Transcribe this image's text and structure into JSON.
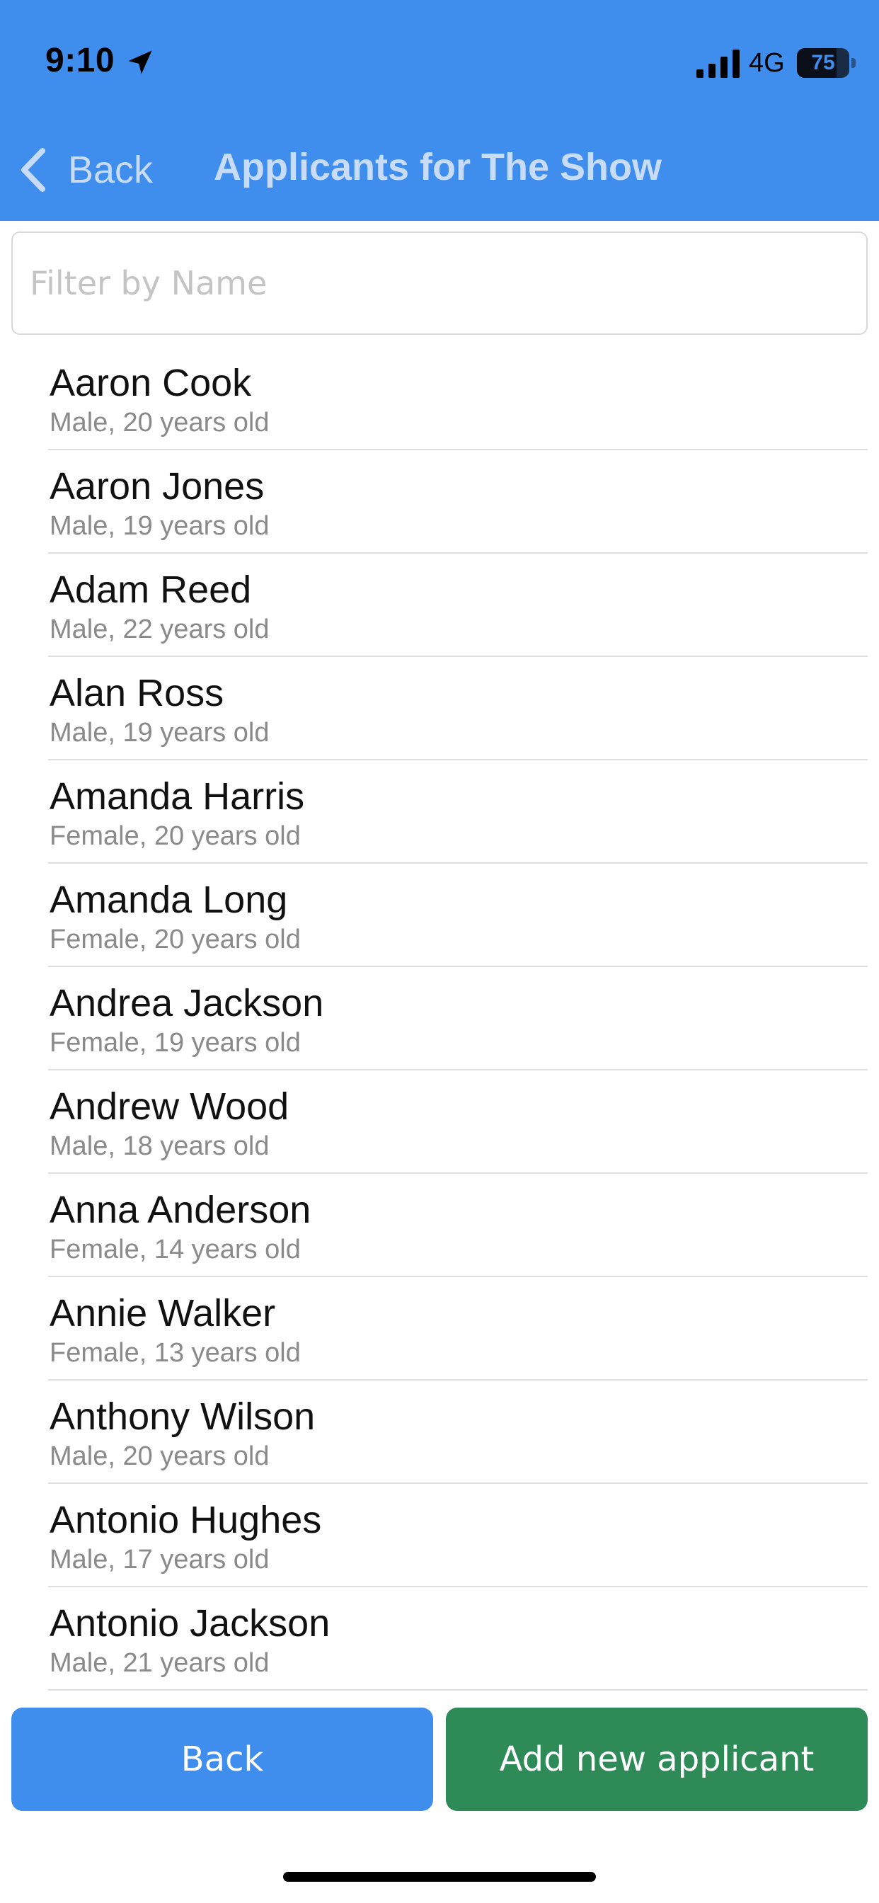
{
  "status_bar": {
    "time": "9:10",
    "network": "4G",
    "battery_level": "75",
    "battery_fraction": 0.75
  },
  "nav": {
    "back_label": "Back",
    "title": "Applicants for The Show"
  },
  "filter": {
    "placeholder": "Filter by Name",
    "value": ""
  },
  "applicants": [
    {
      "name": "Aaron Cook",
      "detail": "Male, 20 years old"
    },
    {
      "name": "Aaron Jones",
      "detail": "Male, 19 years old"
    },
    {
      "name": "Adam Reed",
      "detail": "Male, 22 years old"
    },
    {
      "name": "Alan Ross",
      "detail": "Male, 19 years old"
    },
    {
      "name": "Amanda Harris",
      "detail": "Female, 20 years old"
    },
    {
      "name": "Amanda Long",
      "detail": "Female, 20 years old"
    },
    {
      "name": "Andrea Jackson",
      "detail": "Female, 19 years old"
    },
    {
      "name": "Andrew Wood",
      "detail": "Male, 18 years old"
    },
    {
      "name": "Anna Anderson",
      "detail": "Female, 14 years old"
    },
    {
      "name": "Annie Walker",
      "detail": "Female, 13 years old"
    },
    {
      "name": "Anthony Wilson",
      "detail": "Male, 20 years old"
    },
    {
      "name": "Antonio Hughes",
      "detail": "Male, 17 years old"
    },
    {
      "name": "Antonio Jackson",
      "detail": "Male, 21 years old"
    }
  ],
  "footer": {
    "back_label": "Back",
    "add_label": "Add new applicant"
  },
  "colors": {
    "header_blue": "#3f8ded",
    "add_green": "#2e8b57",
    "detail_gray": "#8a8a8a"
  }
}
